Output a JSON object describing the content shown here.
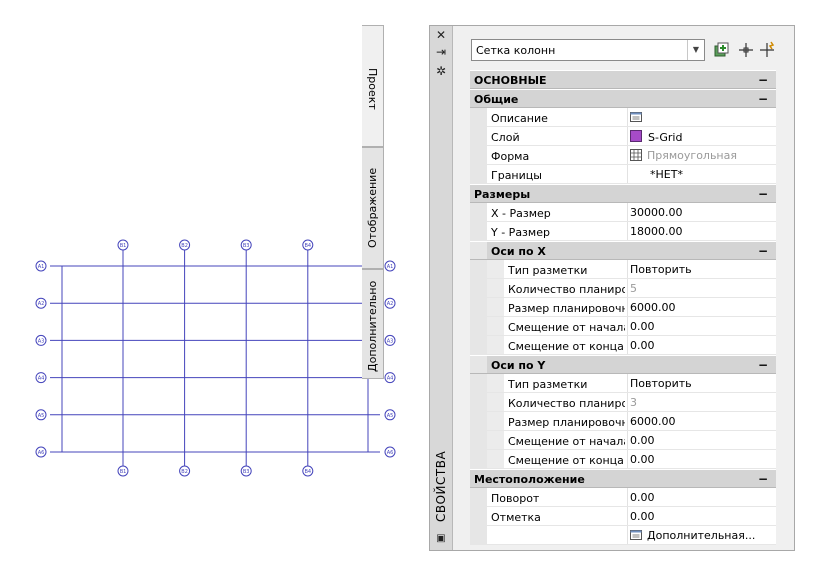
{
  "palette": {
    "title": "СВОЙСТВА",
    "object_type": "Сетка колонн",
    "tabs": [
      "Проект",
      "Отображение",
      "Дополнительно"
    ],
    "sections": [
      {
        "kind": "cat",
        "level": 0,
        "label": "ОСНОВНЫЕ",
        "toggle": "−"
      },
      {
        "kind": "cat",
        "level": 1,
        "label": "Общие",
        "toggle": "−"
      },
      {
        "kind": "prop",
        "level": 1,
        "label": "Описание",
        "value": "",
        "icon": "description-icon"
      },
      {
        "kind": "prop",
        "level": 1,
        "label": "Слой",
        "value": "S-Grid",
        "icon": "layer-color-swatch"
      },
      {
        "kind": "prop",
        "level": 1,
        "label": "Форма",
        "value": "Прямоугольная",
        "icon": "grid-shape-icon",
        "grey": true
      },
      {
        "kind": "prop",
        "level": 1,
        "label": "Границы",
        "value": "*НЕТ*",
        "indent_value": true
      },
      {
        "kind": "cat",
        "level": 0,
        "label": "Размеры",
        "toggle": "−"
      },
      {
        "kind": "prop",
        "level": 1,
        "label": "X - Размер",
        "value": "30000.00"
      },
      {
        "kind": "prop",
        "level": 1,
        "label": "Y - Размер",
        "value": "18000.00"
      },
      {
        "kind": "cat",
        "level": 2,
        "label": "Оси по  X",
        "toggle": "−"
      },
      {
        "kind": "prop",
        "level": 2,
        "label": "Тип разметки",
        "value": "Повторить"
      },
      {
        "kind": "prop",
        "level": 2,
        "label": "Количество  планиро...",
        "value": "5",
        "grey": true
      },
      {
        "kind": "prop",
        "level": 2,
        "label": "Размер  планировочн...",
        "value": "6000.00"
      },
      {
        "kind": "prop",
        "level": 2,
        "label": "Смещение от начала",
        "value": "0.00"
      },
      {
        "kind": "prop",
        "level": 2,
        "label": "Смещение от конца",
        "value": "0.00"
      },
      {
        "kind": "cat",
        "level": 2,
        "label": "Оси по Y",
        "toggle": "−"
      },
      {
        "kind": "prop",
        "level": 2,
        "label": "Тип разметки",
        "value": "Повторить"
      },
      {
        "kind": "prop",
        "level": 2,
        "label": "Количество  планиро...",
        "value": "3",
        "grey": true
      },
      {
        "kind": "prop",
        "level": 2,
        "label": "Размер  планировочн...",
        "value": "6000.00"
      },
      {
        "kind": "prop",
        "level": 2,
        "label": "Смещение от начала",
        "value": "0.00"
      },
      {
        "kind": "prop",
        "level": 2,
        "label": "Смещение от конца",
        "value": "0.00"
      },
      {
        "kind": "cat",
        "level": 0,
        "label": "Местоположение",
        "toggle": "−"
      },
      {
        "kind": "prop",
        "level": 1,
        "label": "Поворот",
        "value": "0.00"
      },
      {
        "kind": "prop",
        "level": 1,
        "label": "Отметка",
        "value": "0.00"
      },
      {
        "kind": "prop",
        "level": 1,
        "label": "",
        "value": "Дополнительная...",
        "icon": "additional-info-icon"
      }
    ]
  },
  "grid": {
    "color": "#4444bb",
    "top_bubbles": [
      "B1",
      "B2",
      "B3",
      "B4"
    ],
    "bottom_bubbles": [
      "B1",
      "B2",
      "B3",
      "B4"
    ],
    "left_bubbles": [
      "A1",
      "A2",
      "A3",
      "A4",
      "A5",
      "A6"
    ],
    "right_bubbles": [
      "A1",
      "A2",
      "A3",
      "A4",
      "A5",
      "A6"
    ]
  }
}
